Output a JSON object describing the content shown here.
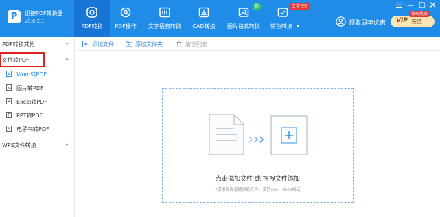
{
  "brand": {
    "app_name": "迅捷PDF转换器",
    "version": "v9.0.2.1",
    "logo_letter": "P"
  },
  "nav_tabs": [
    {
      "label": "PDF转换",
      "icon": "pdf-convert-icon",
      "active": true
    },
    {
      "label": "PDF操作",
      "icon": "pdf-operation-icon"
    },
    {
      "label": "文字语音转换",
      "icon": "text-speech-icon"
    },
    {
      "label": "CAD转换",
      "icon": "cad-convert-icon"
    },
    {
      "label": "图片格式转换",
      "icon": "image-format-icon",
      "badge": "新"
    },
    {
      "label": "特色转换",
      "icon": "special-convert-icon",
      "badge": "文字识别",
      "dropdown": true
    }
  ],
  "account": {
    "label": "领取周年优惠",
    "icon": "user-icon"
  },
  "vip": {
    "text": "VIP",
    "charge_label": "充值",
    "ribbon": "领取优惠"
  },
  "window_controls": [
    "menu-icon",
    "minimize-icon",
    "maximize-icon",
    "close-icon"
  ],
  "sidebar": {
    "groups": [
      {
        "label": "PDF转换其他",
        "expanded": false
      },
      {
        "label": "文件转PDF",
        "expanded": true
      },
      {
        "label": "WPS文件转换",
        "expanded": false
      }
    ],
    "items": [
      {
        "label": "Word转PDF",
        "icon": "word-file-icon",
        "active": true
      },
      {
        "label": "图片转PDF",
        "icon": "image-file-icon"
      },
      {
        "label": "Excel转PDF",
        "icon": "excel-file-icon"
      },
      {
        "label": "PPT转PDF",
        "icon": "ppt-file-icon"
      },
      {
        "label": "电子书转PDF",
        "icon": "ebook-file-icon"
      }
    ]
  },
  "toolbar": {
    "add_file_label": "添加文件",
    "add_folder_label": "添加文件夹",
    "clear_list_label": "清空列表"
  },
  "dropzone": {
    "title": "点击添加文件 或 拖拽文件添加",
    "hint": "*请添加需要转换的文件，支持doc、docx格式"
  },
  "colors": {
    "header_blue": "#1f8ce8",
    "active_tab": "#1875d6",
    "link_blue": "#2e7fd8",
    "highlight_red": "#e02020",
    "badge_green": "#3cc46f",
    "badge_red": "#e53935",
    "vip_gold": "#fde6b3"
  }
}
